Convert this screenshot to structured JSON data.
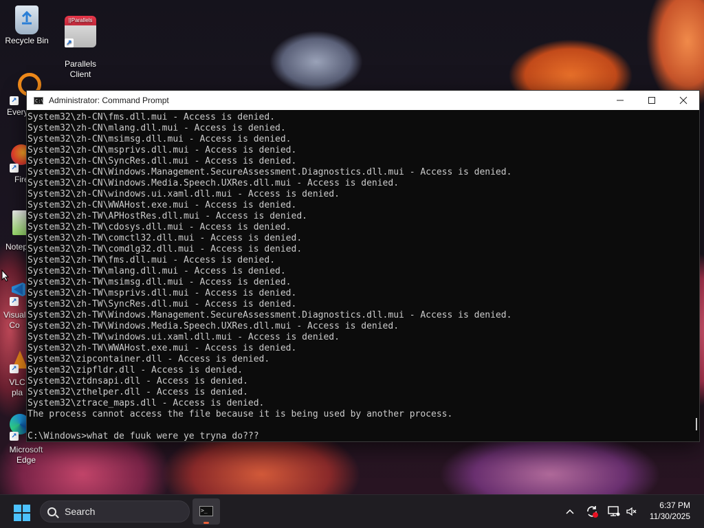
{
  "desktop": {
    "icons": [
      {
        "label": "Recycle Bin"
      },
      {
        "label": "Parallels\nClient",
        "badge": "||Parallels"
      }
    ],
    "partial_icons": [
      {
        "label": "Every"
      },
      {
        "label": "Fire"
      },
      {
        "label": "Notep"
      },
      {
        "label": "Visual\nCo"
      },
      {
        "label": "VLC\npla"
      },
      {
        "label": "Microsoft\nEdge"
      }
    ]
  },
  "window": {
    "title": "Administrator: Command Prompt",
    "icon": "cmd-icon",
    "controls": {
      "minimize": "─",
      "maximize": "☐",
      "close": "✕"
    },
    "console_lines": [
      "System32\\zh-CN\\fms.dll.mui - Access is denied.",
      "System32\\zh-CN\\mlang.dll.mui - Access is denied.",
      "System32\\zh-CN\\msimsg.dll.mui - Access is denied.",
      "System32\\zh-CN\\msprivs.dll.mui - Access is denied.",
      "System32\\zh-CN\\SyncRes.dll.mui - Access is denied.",
      "System32\\zh-CN\\Windows.Management.SecureAssessment.Diagnostics.dll.mui - Access is denied.",
      "System32\\zh-CN\\Windows.Media.Speech.UXRes.dll.mui - Access is denied.",
      "System32\\zh-CN\\windows.ui.xaml.dll.mui - Access is denied.",
      "System32\\zh-CN\\WWAHost.exe.mui - Access is denied.",
      "System32\\zh-TW\\APHostRes.dll.mui - Access is denied.",
      "System32\\zh-TW\\cdosys.dll.mui - Access is denied.",
      "System32\\zh-TW\\comctl32.dll.mui - Access is denied.",
      "System32\\zh-TW\\comdlg32.dll.mui - Access is denied.",
      "System32\\zh-TW\\fms.dll.mui - Access is denied.",
      "System32\\zh-TW\\mlang.dll.mui - Access is denied.",
      "System32\\zh-TW\\msimsg.dll.mui - Access is denied.",
      "System32\\zh-TW\\msprivs.dll.mui - Access is denied.",
      "System32\\zh-TW\\SyncRes.dll.mui - Access is denied.",
      "System32\\zh-TW\\Windows.Management.SecureAssessment.Diagnostics.dll.mui - Access is denied.",
      "System32\\zh-TW\\Windows.Media.Speech.UXRes.dll.mui - Access is denied.",
      "System32\\zh-TW\\windows.ui.xaml.dll.mui - Access is denied.",
      "System32\\zh-TW\\WWAHost.exe.mui - Access is denied.",
      "System32\\zipcontainer.dll - Access is denied.",
      "System32\\zipfldr.dll - Access is denied.",
      "System32\\ztdnsapi.dll - Access is denied.",
      "System32\\zthelper.dll - Access is denied.",
      "System32\\ztrace_maps.dll - Access is denied.",
      "The process cannot access the file because it is being used by another process.",
      "",
      "C:\\Windows>what de fuuk were ye tryna do???"
    ]
  },
  "taskbar": {
    "search_label": "Search",
    "pinned_app": "command-prompt-icon",
    "tray_icons": [
      "chevron-up-icon",
      "update-icon",
      "display-icon",
      "volume-muted-icon"
    ],
    "time": "6:37 PM",
    "date": "11/30/2025"
  },
  "colors": {
    "console_bg": "#0c0c0c",
    "console_text": "#cccccc",
    "taskbar_bg": "#1f1d22",
    "start_accent": "#4cc2ff"
  }
}
